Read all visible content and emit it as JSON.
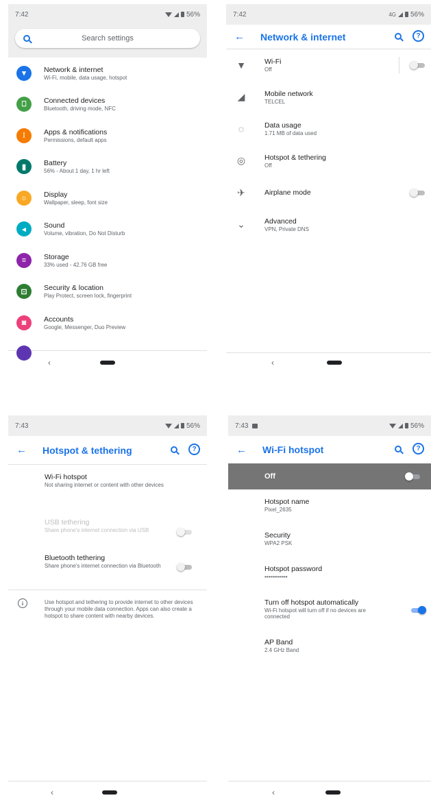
{
  "colors": {
    "accent": "#1a73e8",
    "status_bar": "#eeeeee",
    "off_bar": "#757575"
  },
  "panel1": {
    "time": "7:42",
    "battery": "56%",
    "search_placeholder": "Search settings",
    "items": [
      {
        "title": "Network & internet",
        "sub": "Wi-Fi, mobile, data usage, hotspot",
        "color": "#1a73e8",
        "icon": "wifi-icon"
      },
      {
        "title": "Connected devices",
        "sub": "Bluetooth, driving mode, NFC",
        "color": "#43a047",
        "icon": "devices-icon"
      },
      {
        "title": "Apps & notifications",
        "sub": "Permissions, default apps",
        "color": "#f57c00",
        "icon": "apps-icon"
      },
      {
        "title": "Battery",
        "sub": "56% - About 1 day, 1 hr left",
        "color": "#00796b",
        "icon": "battery-icon"
      },
      {
        "title": "Display",
        "sub": "Wallpaper, sleep, font size",
        "color": "#f9a825",
        "icon": "brightness-icon"
      },
      {
        "title": "Sound",
        "sub": "Volume, vibration, Do Not Disturb",
        "color": "#00acc1",
        "icon": "volume-icon"
      },
      {
        "title": "Storage",
        "sub": "33% used - 42.76 GB free",
        "color": "#8e24aa",
        "icon": "storage-icon"
      },
      {
        "title": "Security & location",
        "sub": "Play Protect, screen lock, fingerprint",
        "color": "#2e7d32",
        "icon": "lock-icon"
      },
      {
        "title": "Accounts",
        "sub": "Google, Messenger, Duo Preview",
        "color": "#ec407a",
        "icon": "account-icon"
      }
    ]
  },
  "panel2": {
    "time": "7:42",
    "network": "4G",
    "battery": "56%",
    "title": "Network & internet",
    "rows": [
      {
        "title": "Wi-Fi",
        "sub": "Off",
        "icon": "wifi-icon"
      },
      {
        "title": "Mobile network",
        "sub": "TELCEL",
        "icon": "signal-icon"
      },
      {
        "title": "Data usage",
        "sub": "1.71 MB of data used",
        "icon": "data-usage-icon"
      },
      {
        "title": "Hotspot & tethering",
        "sub": "Off",
        "icon": "hotspot-icon"
      },
      {
        "title": "Airplane mode",
        "sub": "",
        "icon": "airplane-icon"
      },
      {
        "title": "Advanced",
        "sub": "VPN, Private DNS",
        "icon": "chevron-down-icon"
      }
    ]
  },
  "panel3": {
    "time": "7:43",
    "battery": "56%",
    "title": "Hotspot & tethering",
    "wifi_hotspot": {
      "title": "Wi-Fi hotspot",
      "sub": "Not sharing internet or content with other devices"
    },
    "usb": {
      "title": "USB tethering",
      "sub": "Share phone's internet connection via USB"
    },
    "bluetooth": {
      "title": "Bluetooth tethering",
      "sub": "Share phone's internet connection via Bluetooth"
    },
    "info": "Use hotspot and tethering to provide internet to other devices through your mobile data connection. Apps can also create a hotspot to share content with nearby devices."
  },
  "panel4": {
    "time": "7:43",
    "battery": "56%",
    "title": "Wi-Fi hotspot",
    "off_label": "Off",
    "rows": [
      {
        "title": "Hotspot name",
        "sub": "Pixel_2635"
      },
      {
        "title": "Security",
        "sub": "WPA2 PSK"
      },
      {
        "title": "Hotspot password",
        "sub": "••••••••••••"
      },
      {
        "title": "Turn off hotspot automatically",
        "sub": "Wi-Fi hotspot will turn off if no devices are connected"
      },
      {
        "title": "AP Band",
        "sub": "2.4 GHz Band"
      }
    ],
    "auto_off_enabled": true
  },
  "nav": {
    "back_glyph": "‹"
  }
}
